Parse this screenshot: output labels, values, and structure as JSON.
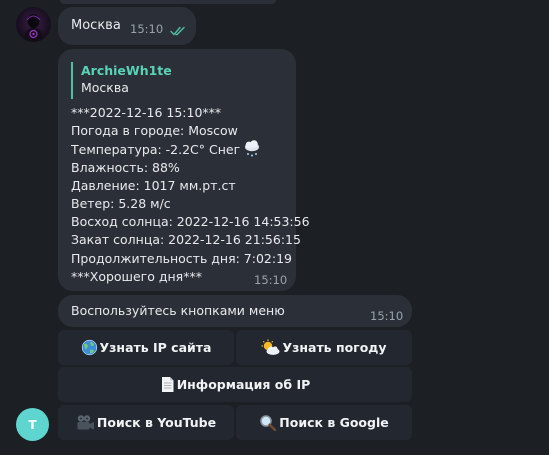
{
  "messages": {
    "user_msg": {
      "text": "Москва",
      "time": "15:10"
    },
    "weather": {
      "reply_name": "ArchieWh1te",
      "reply_text": "Москва",
      "lines": [
        "***2022-12-16 15:10***",
        "Погода в городе: Moscow",
        "Температура: -2.2C° Снег",
        "Влажность: 88%",
        "Давление: 1017 мм.рт.ст",
        "Ветер: 5.28 м/с",
        "Восход солнца: 2022-12-16 14:53:56",
        "Закат солнца: 2022-12-16 21:56:15",
        "Продолжительность дня: 7:02:19",
        "***Хорошего дня***"
      ],
      "time": "15:10"
    },
    "menu_hint": {
      "text": "Воспользуйтесь кнопками меню",
      "time": "15:10"
    }
  },
  "keyboard": {
    "ip_site": "Узнать IP сайта",
    "weather": "Узнать погоду",
    "ip_info": "Информация об IP",
    "youtube": "Поиск в YouTube",
    "google": "Поиск в Google"
  },
  "bot_avatar_letter": "T",
  "icons": {
    "read_ticks": "double-check-icon",
    "snow": "snow-cloud-icon",
    "globe": "globe-icon",
    "sun_cloud": "sun-behind-cloud-icon",
    "page": "page-icon",
    "film": "film-camera-icon",
    "magnifier": "magnifier-icon"
  },
  "colors": {
    "background": "#1c2025",
    "bubble": "#2b3038",
    "button": "#232830",
    "reply_accent": "#59d3b6",
    "ticks": "#4fbfa4",
    "bot_avatar": "#5ed6cf"
  }
}
